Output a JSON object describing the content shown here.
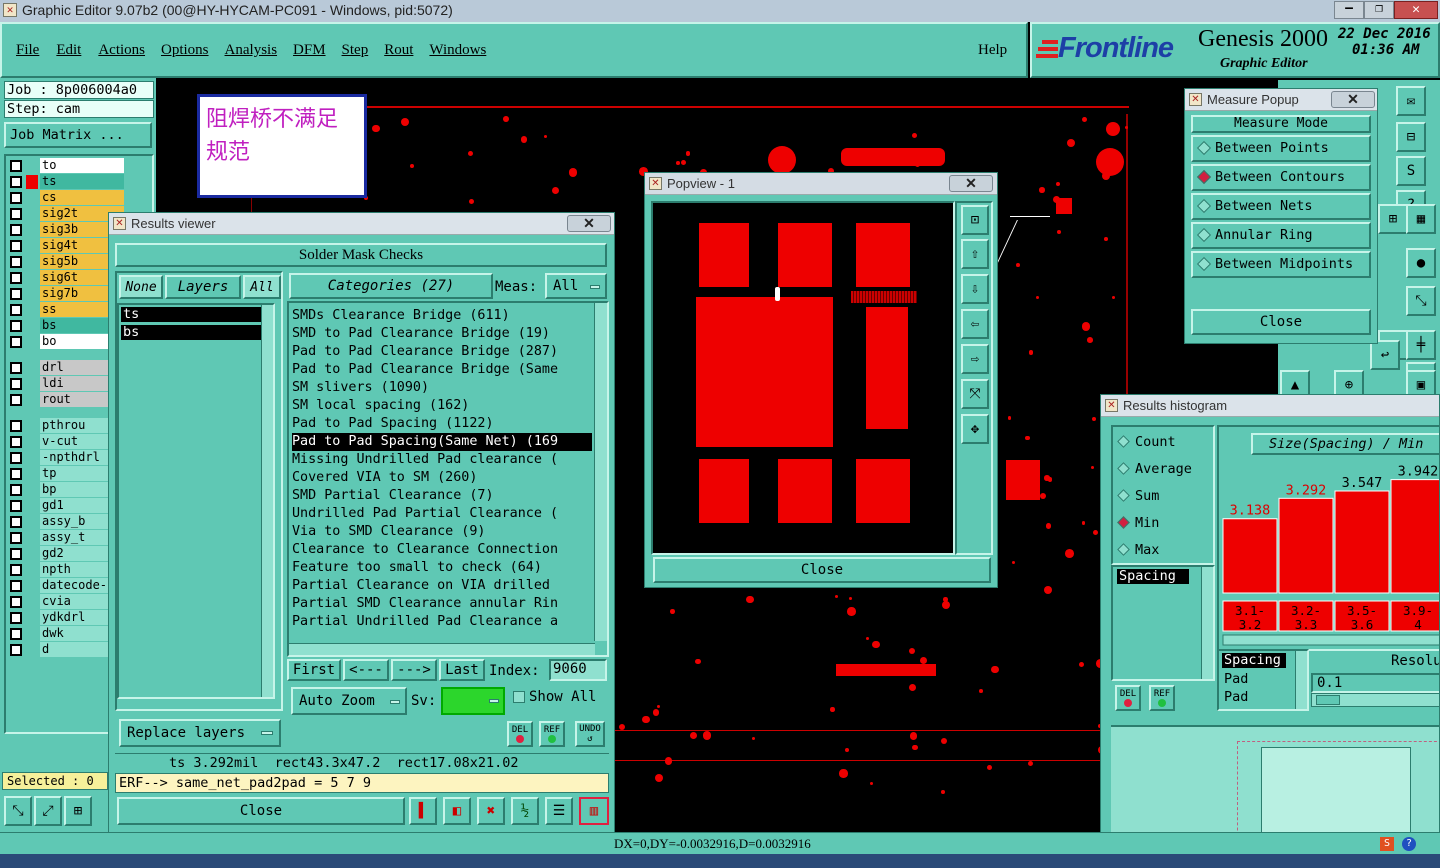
{
  "app": {
    "title": "Graphic Editor 9.07b2 (00@HY-HYCAM-PC091 - Windows, pid:5072)",
    "menu": [
      "File",
      "Edit",
      "Actions",
      "Options",
      "Analysis",
      "DFM",
      "Step",
      "Rout",
      "Windows"
    ],
    "help": "Help"
  },
  "brand": {
    "logo": "Frontline",
    "product": "Genesis 2000",
    "subtitle": "Graphic Editor",
    "date": "22 Dec 2016",
    "time": "01:36 AM"
  },
  "job": {
    "job_label": "Job : 8p006004a0",
    "step_label": "Step: cam",
    "matrix_btn": "Job Matrix ...",
    "selected": "Selected : 0"
  },
  "layers": [
    {
      "name": "to",
      "color": "#ffffff"
    },
    {
      "name": "ts",
      "color": "#40b8a0"
    },
    {
      "name": "cs",
      "color": "#f0c040"
    },
    {
      "name": "sig2t",
      "color": "#f0c040"
    },
    {
      "name": "sig3b",
      "color": "#f0c040"
    },
    {
      "name": "sig4t",
      "color": "#f0c040"
    },
    {
      "name": "sig5b",
      "color": "#f0c040"
    },
    {
      "name": "sig6t",
      "color": "#f0c040"
    },
    {
      "name": "sig7b",
      "color": "#f0c040"
    },
    {
      "name": "ss",
      "color": "#f0c040"
    },
    {
      "name": "bs",
      "color": "#40b8a0"
    },
    {
      "name": "bo",
      "color": "#ffffff"
    },
    {
      "name": "drl",
      "color": "#c8c8c8"
    },
    {
      "name": "ldi",
      "color": "#c8c8c8"
    },
    {
      "name": "rout",
      "color": "#c8c8c8"
    },
    {
      "name": "pthrou",
      "color": "#8fe0cf"
    },
    {
      "name": "v-cut",
      "color": "#8fe0cf"
    },
    {
      "name": "-npthdrl",
      "color": "#8fe0cf"
    },
    {
      "name": "tp",
      "color": "#8fe0cf"
    },
    {
      "name": "bp",
      "color": "#8fe0cf"
    },
    {
      "name": "gd1",
      "color": "#8fe0cf"
    },
    {
      "name": "assy_b",
      "color": "#8fe0cf"
    },
    {
      "name": "assy_t",
      "color": "#8fe0cf"
    },
    {
      "name": "gd2",
      "color": "#8fe0cf"
    },
    {
      "name": "npth",
      "color": "#8fe0cf"
    },
    {
      "name": "datecode-",
      "color": "#8fe0cf"
    },
    {
      "name": "cvia",
      "color": "#8fe0cf"
    },
    {
      "name": "ydkdrl",
      "color": "#8fe0cf"
    },
    {
      "name": "dwk",
      "color": "#8fe0cf"
    },
    {
      "name": "d",
      "color": "#8fe0cf"
    }
  ],
  "note": {
    "text": "阻焊桥不满足规范"
  },
  "results_viewer": {
    "title": "Results viewer",
    "header": "Solder Mask Checks",
    "none_btn": "None",
    "layers_btn": "Layers",
    "all_btn": "All",
    "layer_items": [
      "ts",
      "bs"
    ],
    "categories_label": "Categories (27)",
    "meas_label": "Meas:",
    "meas_value": "All",
    "categories": [
      "SMDs Clearance Bridge (611)",
      "SMD to Pad Clearance Bridge (19)",
      "Pad to Pad Clearance Bridge (287)",
      "Pad to Pad Clearance Bridge (Same",
      "SM slivers (1090)",
      "SM local spacing (162)",
      "Pad to Pad Spacing (1122)",
      "Pad to Pad Spacing(Same Net) (169",
      "Missing Undrilled Pad clearance (",
      "Covered VIA to SM (260)",
      "SMD Partial Clearance (7)",
      "Undrilled Pad Partial Clearance (",
      "Via to SMD Clearance (9)",
      "Clearance to Clearance Connection",
      "Feature too small to check (64)",
      "Partial Clearance on VIA drilled",
      "Partial SMD Clearance annular Rin",
      "Partial Undrilled Pad Clearance a"
    ],
    "selected_index": 7,
    "first": "First",
    "prev": "<---",
    "next": "--->",
    "last": "Last",
    "index_label": "Index:",
    "index_value": "9060",
    "auto_zoom": "Auto Zoom",
    "sv_label": "Sv:",
    "show_all": "Show All",
    "replace_layers": "Replace layers",
    "del": "DEL",
    "ref": "REF",
    "undo": "UNDO",
    "status": "ts 3.292mil  rect43.3x47.2  rect17.08x21.02",
    "erf": "ERF--> same_net_pad2pad = 5 7 9",
    "close": "Close"
  },
  "popview": {
    "title": "Popview - 1",
    "close": "Close"
  },
  "measure": {
    "title": "Measure Popup",
    "mode_label": "Measure Mode",
    "options": [
      "Between Points",
      "Between Contours",
      "Between Nets",
      "Annular Ring",
      "Between Midpoints"
    ],
    "selected": 1,
    "close": "Close"
  },
  "histogram": {
    "title": "Results histogram",
    "options": [
      "Count",
      "Average",
      "Sum",
      "Min",
      "Max"
    ],
    "selected": 3,
    "chart_title": "Size(Spacing) / Min",
    "left_list": [
      "Spacing"
    ],
    "bottom_list": [
      "Spacing",
      "Pad",
      "Pad"
    ],
    "resolution_label": "Resolu",
    "resolution_value": "0.1",
    "del": "DEL",
    "ref": "REF"
  },
  "chart_data": {
    "type": "bar",
    "title": "Size(Spacing) / Min",
    "categories": [
      "3.1-3.2",
      "3.2-3.3",
      "3.5-3.6",
      "3.9-4"
    ],
    "values": [
      3.138,
      3.292,
      3.547,
      3.942
    ],
    "value_labels": [
      "3.138",
      "3.292",
      "3.547",
      "3.942"
    ],
    "ylim": [
      0,
      4.6
    ]
  },
  "statusbar": {
    "coords": "DX=0,DY=-0.0032916,D=0.0032916"
  },
  "colors": {
    "teal": "#5fc8b4",
    "pcb_red": "#e00000",
    "highlight": "#d02040"
  }
}
